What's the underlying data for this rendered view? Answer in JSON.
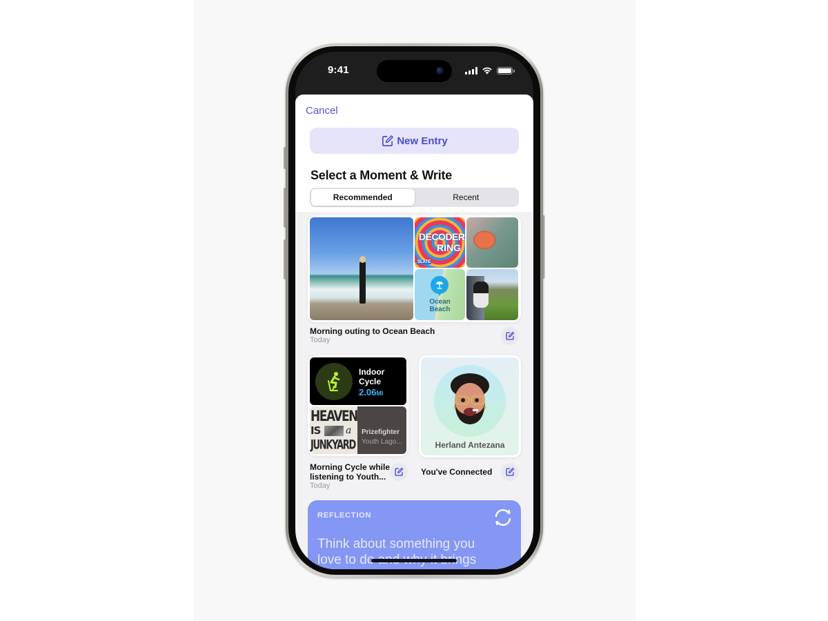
{
  "status_bar": {
    "time": "9:41",
    "signal_icon": "cellular-signal-icon",
    "wifi_icon": "wifi-icon",
    "battery_icon": "battery-icon"
  },
  "sheet": {
    "cancel_label": "Cancel",
    "new_entry_label": "New Entry",
    "new_entry_icon": "compose-icon",
    "section_title": "Select a Moment & Write",
    "tabs": [
      {
        "label": "Recommended",
        "active": true
      },
      {
        "label": "Recent",
        "active": false
      }
    ]
  },
  "moments": [
    {
      "title": "Morning outing to Ocean Beach",
      "subtitle": "Today",
      "tiles": {
        "photo_beach": "Person running out of ocean waves on a beach",
        "podcast_art": {
          "line1": "DECODER",
          "line2": "RING",
          "publisher": "SLATE"
        },
        "photo_shell": "Scallop shell on green fabric",
        "map_location": {
          "name_line1": "Ocean",
          "name_line2": "Beach",
          "pin_icon": "beach-umbrella-icon"
        },
        "photo_dog": "Dog looking out of car window at coast"
      }
    },
    {
      "title": "Morning Cycle while listening to Youth...",
      "subtitle": "Today",
      "workout": {
        "name_line1": "Indoor",
        "name_line2": "Cycle",
        "distance": "2.06",
        "unit": "MI",
        "icon": "indoor-cycle-icon"
      },
      "music": {
        "album_art": {
          "line1": "HEAVEN",
          "line2": "IS",
          "line3": "a",
          "line4": "JUNKYARD"
        },
        "artist": "Prizefighter",
        "album": "Youth Lago..."
      }
    },
    {
      "title": "You've Connected",
      "contact_name": "Herland Antezana",
      "avatar": "memoji-avatar"
    }
  ],
  "reflection": {
    "label": "REFLECTION",
    "prompt": "Think about something you love to do and why it brings",
    "refresh_icon": "refresh-icon"
  },
  "colors": {
    "accent": "#5454d6",
    "new_entry_bg": "#e6e4fb",
    "reflection_bg": "#8597f5",
    "workout_green": "#b8f52e",
    "workout_blue": "#3bb4f5"
  }
}
